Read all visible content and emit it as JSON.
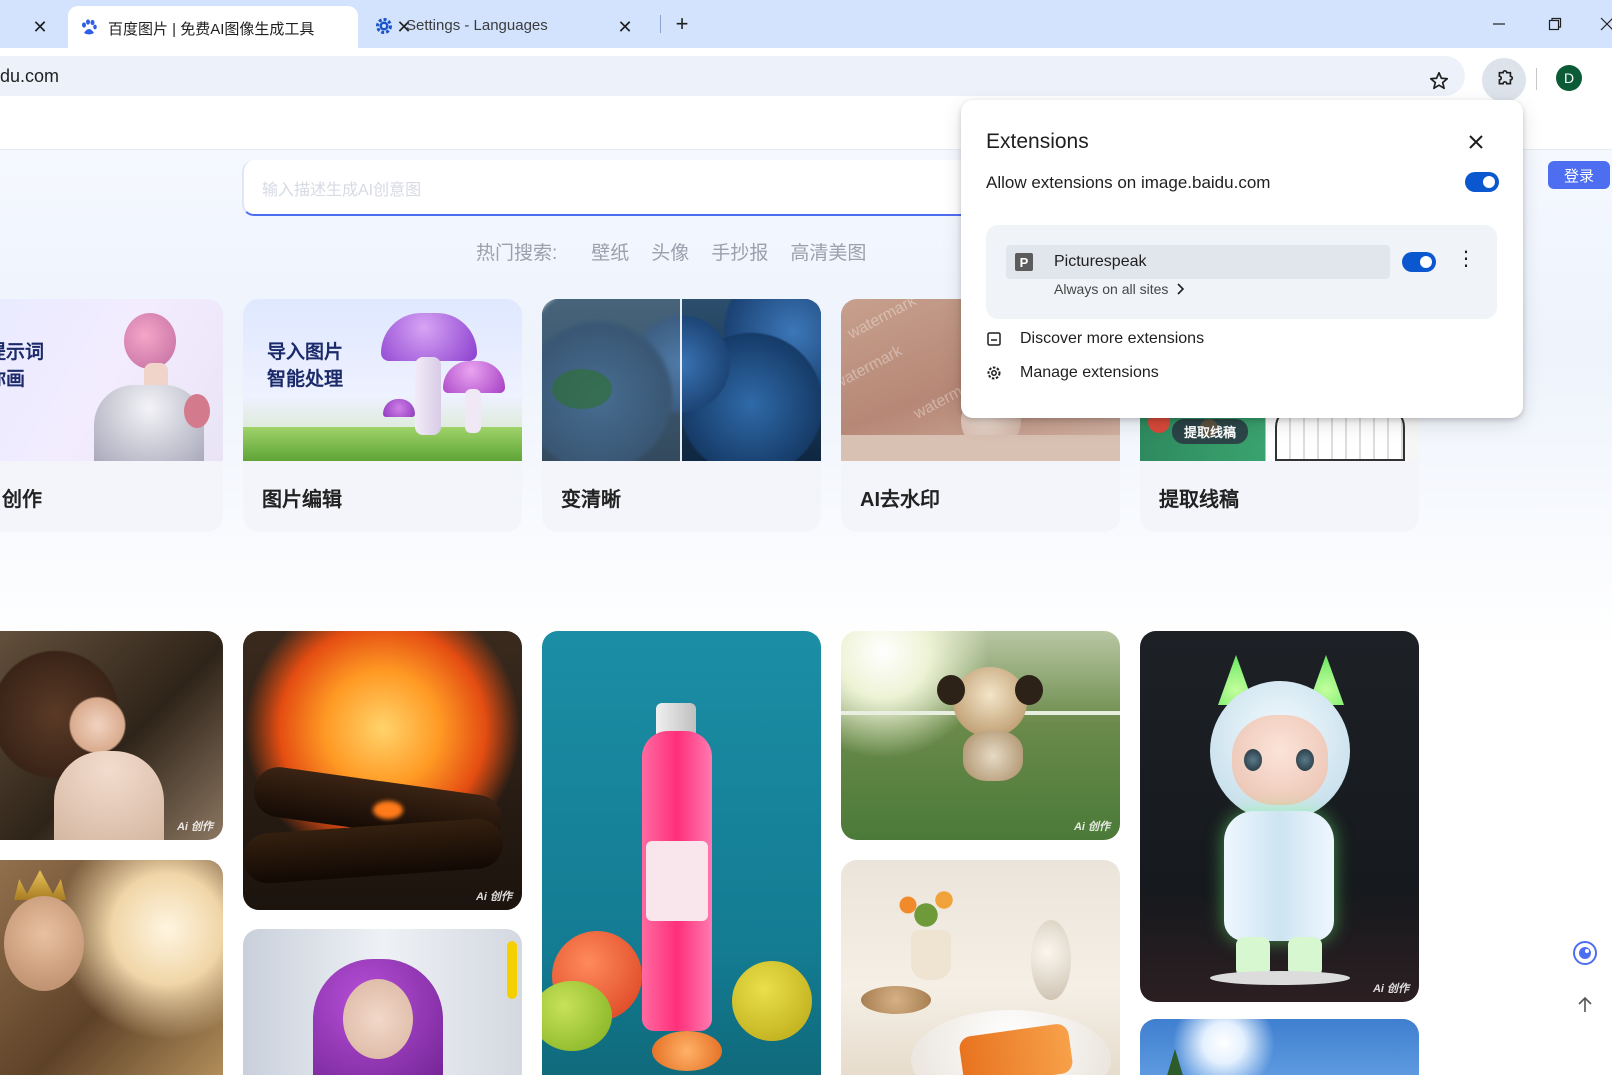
{
  "browser": {
    "tabs": [
      {
        "title": "",
        "close": "✕"
      },
      {
        "title": "百度图片 | 免费AI图像生成工具",
        "close": "✕",
        "active": true
      },
      {
        "title": "Settings - Languages",
        "close": "✕"
      }
    ],
    "new_tab": "+",
    "url": "du.com",
    "avatar_letter": "D"
  },
  "page": {
    "search_placeholder": "输入描述生成AI创意图",
    "login": "登录",
    "hot_label": "热门搜索:",
    "hot_items": [
      "壁纸",
      "头像",
      "手抄报",
      "高清美图"
    ],
    "features": [
      {
        "label": "创作",
        "overlay": "入提示词\n帮你画"
      },
      {
        "label": "图片编辑",
        "overlay": "导入图片\n智能处理"
      },
      {
        "label": "变清晰"
      },
      {
        "label": "AI去水印",
        "watermark": "watermark"
      },
      {
        "label": "提取线稿",
        "badge": "提取线稿"
      }
    ],
    "ai_tag": "Ai 创作"
  },
  "extensions_popup": {
    "title": "Extensions",
    "allow_label": "Allow extensions on image.baidu.com",
    "allow_enabled": true,
    "extension": {
      "icon_letter": "P",
      "name": "Picturespeak",
      "site_access": "Always on all sites",
      "enabled": true
    },
    "discover": "Discover more extensions",
    "manage": "Manage extensions"
  },
  "colors": {
    "tabstrip": "#d3e3fd",
    "accent": "#0b57d0",
    "baidu_blue": "#4e6ef2"
  }
}
